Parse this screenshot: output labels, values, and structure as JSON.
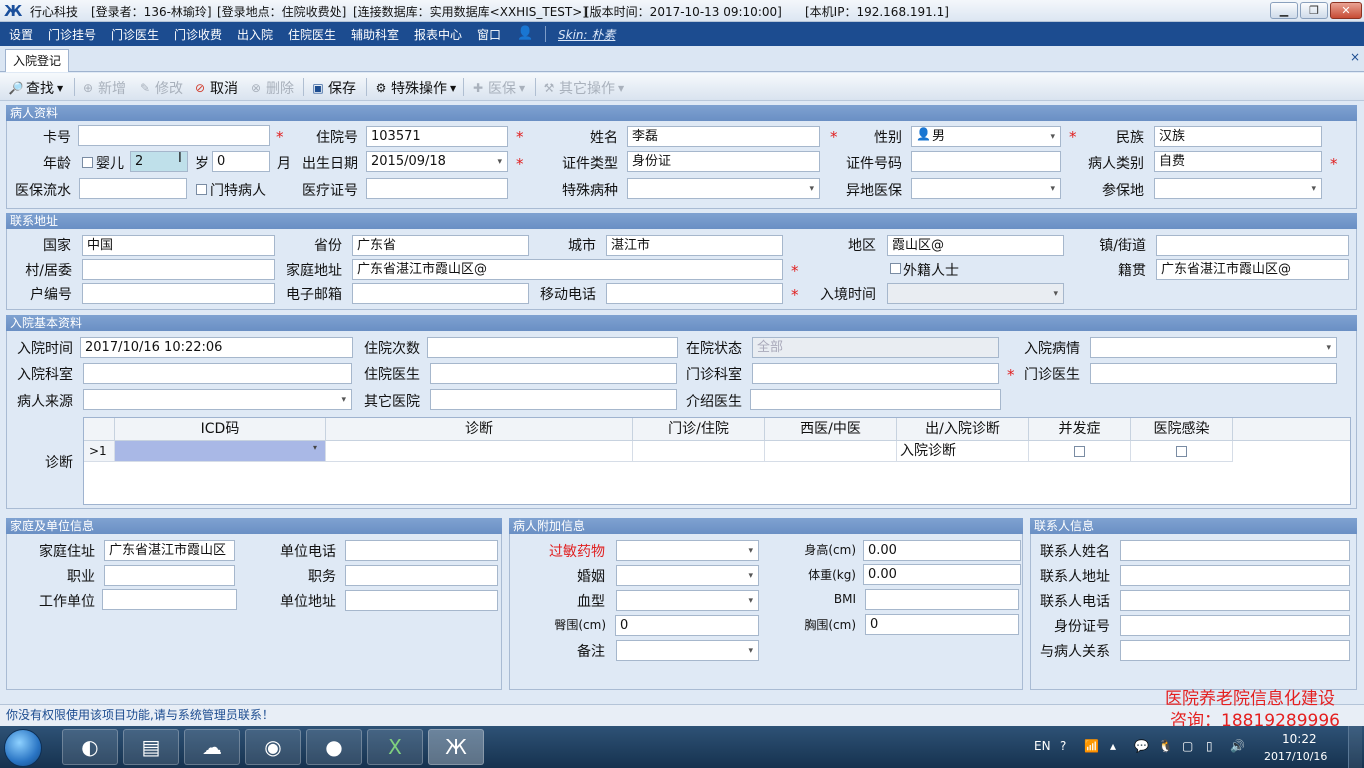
{
  "titlebar": {
    "app_name": "行心科技",
    "login_user": "[登录者：136-林瑜玲]",
    "login_place": "[登录地点：住院收费处]",
    "db": "[连接数据库：实用数据库<XXHIS_TEST>]",
    "version": "[版本时间：2017-10-13 09:10:00]",
    "ip": "[本机IP：192.168.191.1]"
  },
  "menu": {
    "items": [
      "设置",
      "门诊挂号",
      "门诊医生",
      "门诊收费",
      "出入院",
      "住院医生",
      "辅助科室",
      "报表中心",
      "窗口"
    ],
    "skin": "Skin: 朴素"
  },
  "tab": {
    "label": "入院登记",
    "close": "×"
  },
  "toolbar": {
    "search": "查找",
    "add": "新增",
    "edit": "修改",
    "cancel": "取消",
    "delete": "删除",
    "save": "保存",
    "special": "特殊操作",
    "doctor": "医保",
    "other": "其它操作"
  },
  "patient": {
    "header": "病人资料",
    "card_no_label": "卡号",
    "card_no": "",
    "inpatient_no_label": "住院号",
    "inpatient_no": "103571",
    "name_label": "姓名",
    "name": "李磊",
    "gender_label": "性别",
    "gender": "男",
    "ethnicity_label": "民族",
    "ethnicity": "汉族",
    "age_label": "年龄",
    "infant_label": "婴儿",
    "age_years": "2",
    "years_unit": "岁",
    "age_months": "0",
    "months_unit": "月",
    "birth_label": "出生日期",
    "birth": "2015/09/18",
    "idtype_label": "证件类型",
    "idtype": "身份证",
    "idno_label": "证件号码",
    "idno": "",
    "category_label": "病人类别",
    "category": "自费",
    "insurance_flow_label": "医保流水",
    "insurance_flow": "",
    "special_patient_label": "门特病人",
    "medical_cert_label": "医疗证号",
    "medical_cert": "",
    "special_disease_label": "特殊病种",
    "special_disease": "",
    "remote_insurance_label": "异地医保",
    "remote_insurance": "",
    "insured_place_label": "参保地",
    "insured_place": ""
  },
  "address": {
    "header": "联系地址",
    "country_label": "国家",
    "country": "中国",
    "province_label": "省份",
    "province": "广东省",
    "city_label": "城市",
    "city": "湛江市",
    "district_label": "地区",
    "district": "霞山区@",
    "town_label": "镇/街道",
    "town": "",
    "village_label": "村/居委",
    "village": "",
    "home_label": "家庭地址",
    "home": "广东省湛江市霞山区@",
    "foreign_label": "外籍人士",
    "native_label": "籍贯",
    "native": "广东省湛江市霞山区@",
    "household_label": "户编号",
    "household": "",
    "email_label": "电子邮箱",
    "email": "",
    "mobile_label": "移动电话",
    "mobile": "",
    "entry_time_label": "入境时间",
    "entry_time": ""
  },
  "admission": {
    "header": "入院基本资料",
    "time_label": "入院时间",
    "time": "2017/10/16 10:22:06",
    "count_label": "住院次数",
    "count": "",
    "status_label": "在院状态",
    "status": "全部",
    "condition_label": "入院病情",
    "condition": "",
    "dept_label": "入院科室",
    "dept": "",
    "doctor_label": "住院医生",
    "doctor": "",
    "op_dept_label": "门诊科室",
    "op_dept": "",
    "op_doctor_label": "门诊医生",
    "op_doctor": "",
    "source_label": "病人来源",
    "source": "",
    "other_hosp_label": "其它医院",
    "other_hosp": "",
    "referrer_label": "介绍医生",
    "referrer": "",
    "diag_label": "诊断",
    "grid_columns": [
      "ICD码",
      "诊断",
      "门诊/住院",
      "西医/中医",
      "出/入院诊断",
      "并发症",
      "医院感染"
    ],
    "grid_row": {
      "marker": ">1",
      "icd": "",
      "diagnosis": "",
      "op_ip": "",
      "western": "",
      "type": "入院诊断"
    }
  },
  "family": {
    "header": "家庭及单位信息",
    "home_label": "家庭住址",
    "home": "广东省湛江市霞山区",
    "unit_phone_label": "单位电话",
    "unit_phone": "",
    "job_label": "职业",
    "job": "",
    "post_label": "职务",
    "post": "",
    "work_label": "工作单位",
    "work": "",
    "unit_addr_label": "单位地址",
    "unit_addr": ""
  },
  "extra": {
    "header": "病人附加信息",
    "allergy_label": "过敏药物",
    "allergy": "",
    "height_label": "身高(cm)",
    "height": "0.00",
    "marriage_label": "婚姻",
    "marriage": "",
    "weight_label": "体重(kg)",
    "weight": "0.00",
    "blood_label": "血型",
    "blood": "",
    "bmi_label": "BMI",
    "bmi": "",
    "hip_label": "臀围(cm)",
    "hip": "0",
    "chest_label": "胸围(cm)",
    "chest": "0",
    "note_label": "备注",
    "note": ""
  },
  "contact": {
    "header": "联系人信息",
    "name_label": "联系人姓名",
    "name": "",
    "addr_label": "联系人地址",
    "addr": "",
    "phone_label": "联系人电话",
    "phone": "",
    "id_label": "身份证号",
    "id": "",
    "rel_label": "与病人关系",
    "rel": ""
  },
  "status": {
    "message": "你没有权限使用该项目功能,请与系统管理员联系！",
    "promo_line1": "医院养老院信息化建设",
    "promo_line2": "咨询：18819289996"
  },
  "taskbar": {
    "lang": "EN",
    "time": "10:22",
    "date": "2017/10/16"
  },
  "colors": {
    "menu_bg": "#1c4c90",
    "section_header": "#7396c8",
    "required": "#e02020",
    "promo": "#e41f1f"
  }
}
